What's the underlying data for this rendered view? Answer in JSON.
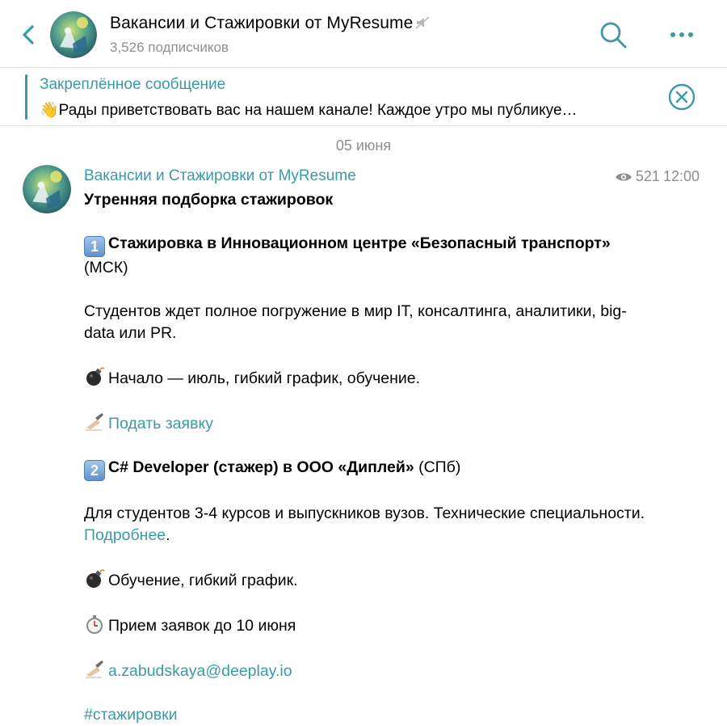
{
  "header": {
    "title": "Вакансии и Стажировки от MyResume",
    "subscribers": "3,526 подписчиков"
  },
  "pinned": {
    "title": "Закреплённое сообщение",
    "text": "👋Рады приветствовать вас на нашем канале!  Каждое утро мы публикуе…"
  },
  "date_separator": "05 июня",
  "message": {
    "sender": "Вакансии и Стажировки от MyResume",
    "views": "521",
    "time": "12:00",
    "heading": "Утренняя подборка стажировок",
    "item1": {
      "num": "1",
      "title": "Стажировка в Инновационном центре «Безопасный транспорт»",
      "city": " (МСК)",
      "desc": "Студентов ждет полное погружение в мир IT, консалтинга, аналитики, big-data или PR.",
      "start": "Начало — июль, гибкий график, обучение.",
      "apply_link": "Подать заявку"
    },
    "item2": {
      "num": "2",
      "title": "C# Developer (стажер) в ООО «Диплей»",
      "city": " (СПб)",
      "desc": "Для студентов 3-4 курсов и выпускников вузов. Технические специальности. ",
      "more_link": "Подробнее",
      "desc_end": ".",
      "training": "Обучение, гибкий график.",
      "deadline": "Прием заявок до 10 июня",
      "email": "a.zabudskaya@deeplay.io"
    },
    "hashtag": "#стажировки"
  },
  "colors": {
    "accent": "#3b9aa6",
    "muted": "#8e8e93"
  }
}
